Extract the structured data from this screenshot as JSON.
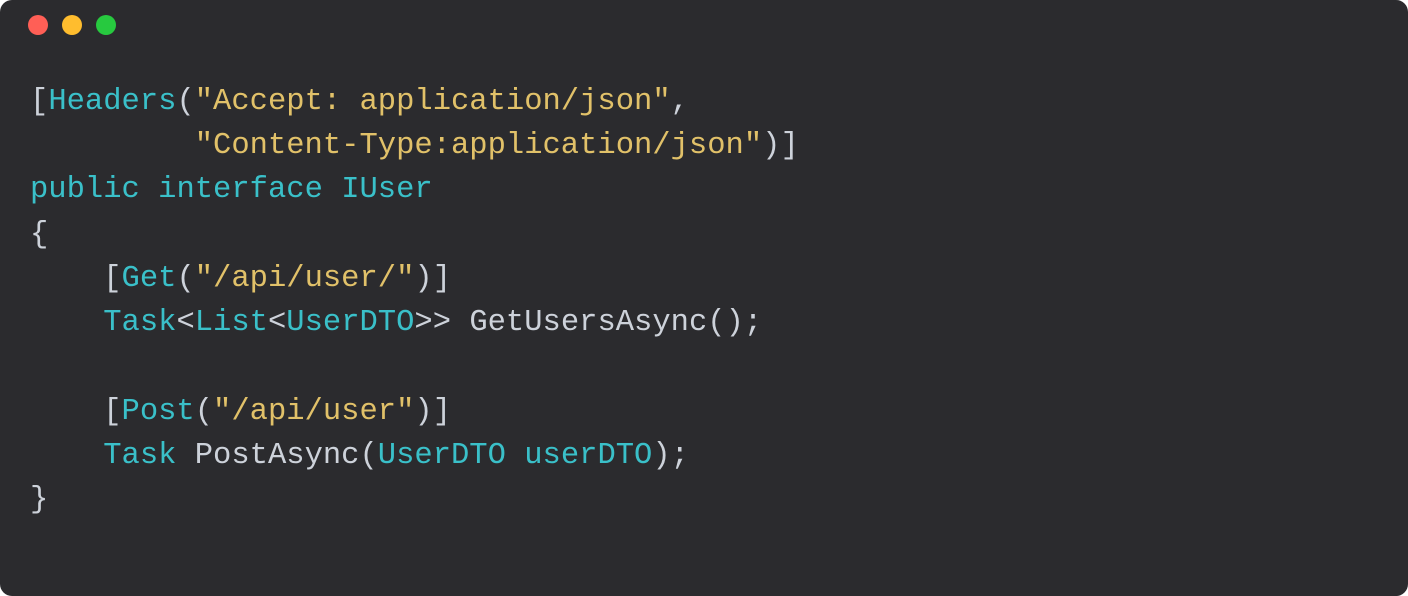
{
  "code": {
    "line1": {
      "t1": "[",
      "t2": "Headers",
      "t3": "(",
      "t4": "\"Accept: application/json\"",
      "t5": ","
    },
    "line2": {
      "t1": "         ",
      "t2": "\"Content-Type:application/json\"",
      "t3": ")]"
    },
    "line3": {
      "t1": "public",
      "t2": " ",
      "t3": "interface",
      "t4": " ",
      "t5": "IUser"
    },
    "line4": {
      "t1": "{"
    },
    "line5": {
      "t1": "    [",
      "t2": "Get",
      "t3": "(",
      "t4": "\"/api/user/\"",
      "t5": ")]"
    },
    "line6": {
      "t1": "    ",
      "t2": "Task",
      "t3": "<",
      "t4": "List",
      "t5": "<",
      "t6": "UserDTO",
      "t7": ">> ",
      "t8": "GetUsersAsync",
      "t9": "();"
    },
    "line7": {
      "t1": ""
    },
    "line8": {
      "t1": "    [",
      "t2": "Post",
      "t3": "(",
      "t4": "\"/api/user\"",
      "t5": ")]"
    },
    "line9": {
      "t1": "    ",
      "t2": "Task",
      "t3": " ",
      "t4": "PostAsync",
      "t5": "(",
      "t6": "UserDTO",
      "t7": " ",
      "t8": "userDTO",
      "t9": ");"
    },
    "line10": {
      "t1": "}"
    }
  }
}
